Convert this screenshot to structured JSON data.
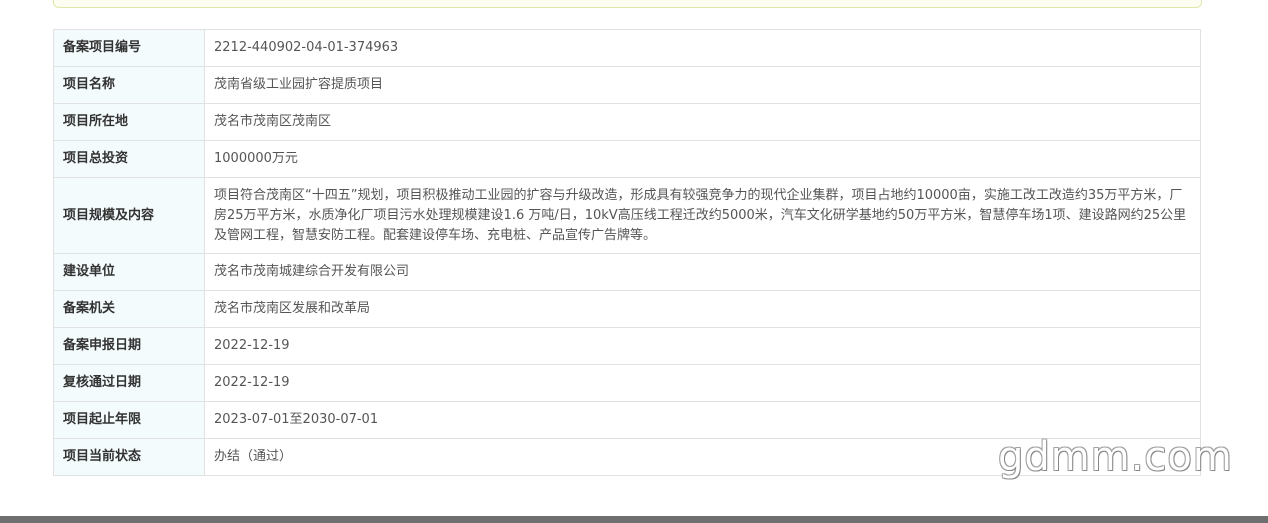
{
  "rows": [
    {
      "label": "备案项目编号",
      "value": "2212-440902-04-01-374963"
    },
    {
      "label": "项目名称",
      "value": "茂南省级工业园扩容提质项目"
    },
    {
      "label": "项目所在地",
      "value": "茂名市茂南区茂南区"
    },
    {
      "label": "项目总投资",
      "value": "1000000万元"
    },
    {
      "label": "项目规模及内容",
      "value": "项目符合茂南区“十四五”规划，项目积极推动工业园的扩容与升级改造，形成具有较强竞争力的现代企业集群，项目占地约10000亩，实施工改工改造约35万平方米，厂房25万平方米，水质净化厂项目污水处理规模建设1.6 万吨/日，10kV高压线工程迁改约5000米，汽车文化研学基地约50万平方米，智慧停车场1项、建设路网约25公里及管网工程，智慧安防工程。配套建设停车场、充电桩、产品宣传广告牌等。"
    },
    {
      "label": "建设单位",
      "value": "茂名市茂南城建综合开发有限公司"
    },
    {
      "label": "备案机关",
      "value": "茂名市茂南区发展和改革局"
    },
    {
      "label": "备案申报日期",
      "value": "2022-12-19"
    },
    {
      "label": "复核通过日期",
      "value": "2022-12-19"
    },
    {
      "label": "项目起止年限",
      "value": "2023-07-01至2030-07-01"
    },
    {
      "label": "项目当前状态",
      "value": "办结（通过）"
    }
  ],
  "watermark": "gdmm.com"
}
